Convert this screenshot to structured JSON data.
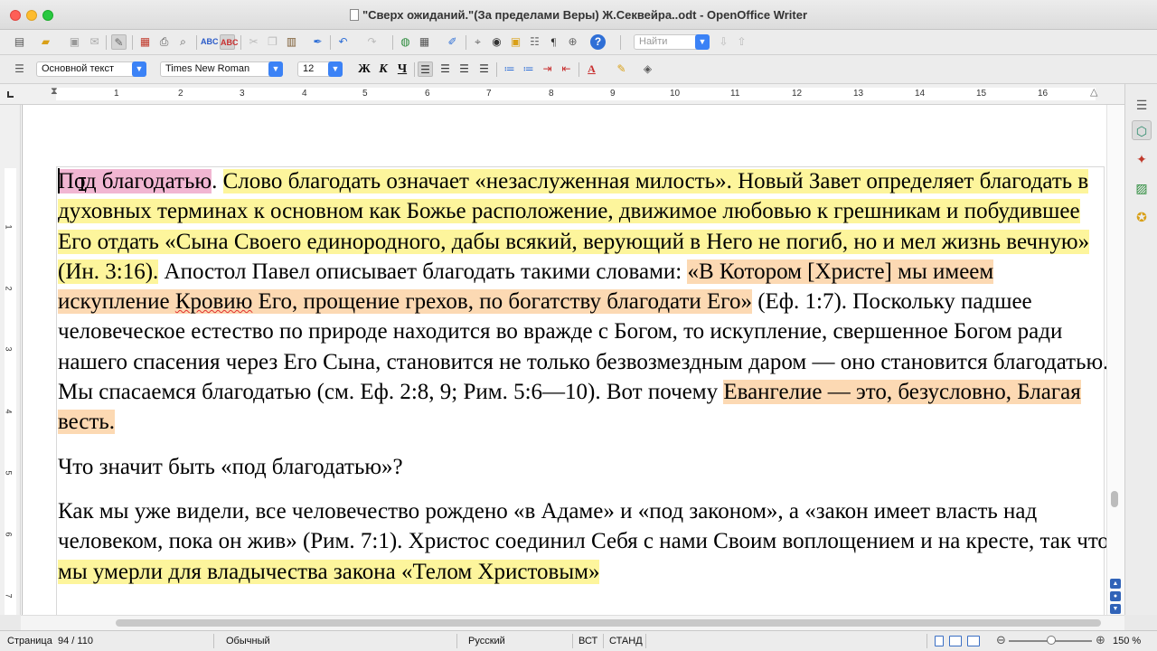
{
  "window": {
    "title": "\"Сверх ожиданий.\"(За пределами Веры) Ж.Секвейра..odt - OpenOffice Writer"
  },
  "toolbar_standard": {
    "find_placeholder": "Найти"
  },
  "toolbar_formatting": {
    "paragraph_style": "Основной текст",
    "font_name": "Times New Roman",
    "font_size": "12",
    "bold_label": "Ж",
    "italic_label": "К",
    "underline_label": "Ч"
  },
  "ruler": {
    "numbers": [
      "1",
      "1",
      "2",
      "3",
      "4",
      "5",
      "6",
      "7",
      "8",
      "9",
      "10",
      "11",
      "12",
      "13",
      "14",
      "15",
      "16"
    ]
  },
  "vertical_ruler": {
    "numbers": [
      "1",
      "2",
      "3",
      "4",
      "5",
      "6",
      "7"
    ]
  },
  "document": {
    "p1": {
      "s1": "Под благодатью",
      "s2": ". ",
      "s3": "Слово благодать означает «незаслуженная милость». Новый Завет определяет благодать в духовных терминах к основном как Божье расположение, движимое любовью к грешникам и побудившее Его отдать «Сына Своего единородного, дабы всякий, верующий в Него не погиб, но и мел жизнь вечную» (Ин. 3:16).",
      "s4": " Апостол Павел описывает благодать такими словами: ",
      "s5a": "«В Котором [Христе] мы имеем искупление ",
      "s5b": "Кровию",
      "s5c": " Его, прощение грехов, по богатству благодати Его»",
      "s6": " (Еф. 1:7). Поскольку падшее человеческое естество по природе находится во вражде с Богом, то искупление, свершенное Богом ради нашего спасения через Его Сына, становится не только безвозмездным даром — оно становится благодатью. Мы спасаемся благодатью (см. Еф. 2:8, 9; Рим. 5:6—10). Вот почему ",
      "s7": "Евангелие — это, безусловно, Благая весть."
    },
    "p2": "Что значит быть «под благодатью»?",
    "p3": {
      "s1": "Как мы уже видели, все человечество рождено «в Адаме» и «под законом», а «закон имеет власть над человеком, пока он жив» (Рим. 7:1). Христос соединил Себя с нами Своим воплощением и на кресте, так что ",
      "s2": "мы умерли для владычества закона «Телом Христовым»"
    }
  },
  "statusbar": {
    "page_label": "Страница",
    "page_value": "94 / 110",
    "page_style": "Обычный",
    "language": "Русский",
    "insert_mode": "ВСТ",
    "selection_mode": "СТАНД",
    "zoom": "150 %"
  },
  "colors": {
    "highlight_pink": "#f1b6d2",
    "highlight_yellow": "#fdf59c",
    "highlight_orange": "#fcd9b3",
    "accent_blue": "#3b82f6"
  },
  "icons": {
    "toolbar_standard": [
      "new-document-icon",
      "open-icon",
      "save-icon",
      "email-icon",
      "edit-file-icon",
      "export-pdf-icon",
      "print-icon",
      "print-preview-icon",
      "spellcheck-icon",
      "auto-spellcheck-icon",
      "cut-icon",
      "copy-icon",
      "paste-icon",
      "format-paintbrush-icon",
      "undo-icon",
      "redo-icon",
      "hyperlink-icon",
      "table-icon",
      "draw-functions-icon",
      "find-replace-icon",
      "navigator-icon",
      "gallery-icon",
      "data-sources-icon",
      "nonprinting-characters-icon",
      "zoom-icon",
      "help-icon"
    ],
    "sidebar": [
      "properties-icon",
      "styles-icon",
      "gallery-icon",
      "navigator-icon"
    ]
  }
}
